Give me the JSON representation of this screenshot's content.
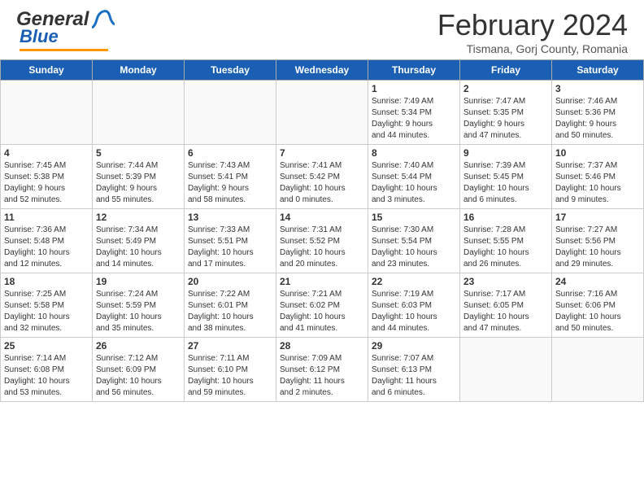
{
  "header": {
    "logo_general": "General",
    "logo_blue": "Blue",
    "title": "February 2024",
    "location": "Tismana, Gorj County, Romania"
  },
  "weekdays": [
    "Sunday",
    "Monday",
    "Tuesday",
    "Wednesday",
    "Thursday",
    "Friday",
    "Saturday"
  ],
  "weeks": [
    [
      {
        "day": "",
        "info": ""
      },
      {
        "day": "",
        "info": ""
      },
      {
        "day": "",
        "info": ""
      },
      {
        "day": "",
        "info": ""
      },
      {
        "day": "1",
        "info": "Sunrise: 7:49 AM\nSunset: 5:34 PM\nDaylight: 9 hours\nand 44 minutes."
      },
      {
        "day": "2",
        "info": "Sunrise: 7:47 AM\nSunset: 5:35 PM\nDaylight: 9 hours\nand 47 minutes."
      },
      {
        "day": "3",
        "info": "Sunrise: 7:46 AM\nSunset: 5:36 PM\nDaylight: 9 hours\nand 50 minutes."
      }
    ],
    [
      {
        "day": "4",
        "info": "Sunrise: 7:45 AM\nSunset: 5:38 PM\nDaylight: 9 hours\nand 52 minutes."
      },
      {
        "day": "5",
        "info": "Sunrise: 7:44 AM\nSunset: 5:39 PM\nDaylight: 9 hours\nand 55 minutes."
      },
      {
        "day": "6",
        "info": "Sunrise: 7:43 AM\nSunset: 5:41 PM\nDaylight: 9 hours\nand 58 minutes."
      },
      {
        "day": "7",
        "info": "Sunrise: 7:41 AM\nSunset: 5:42 PM\nDaylight: 10 hours\nand 0 minutes."
      },
      {
        "day": "8",
        "info": "Sunrise: 7:40 AM\nSunset: 5:44 PM\nDaylight: 10 hours\nand 3 minutes."
      },
      {
        "day": "9",
        "info": "Sunrise: 7:39 AM\nSunset: 5:45 PM\nDaylight: 10 hours\nand 6 minutes."
      },
      {
        "day": "10",
        "info": "Sunrise: 7:37 AM\nSunset: 5:46 PM\nDaylight: 10 hours\nand 9 minutes."
      }
    ],
    [
      {
        "day": "11",
        "info": "Sunrise: 7:36 AM\nSunset: 5:48 PM\nDaylight: 10 hours\nand 12 minutes."
      },
      {
        "day": "12",
        "info": "Sunrise: 7:34 AM\nSunset: 5:49 PM\nDaylight: 10 hours\nand 14 minutes."
      },
      {
        "day": "13",
        "info": "Sunrise: 7:33 AM\nSunset: 5:51 PM\nDaylight: 10 hours\nand 17 minutes."
      },
      {
        "day": "14",
        "info": "Sunrise: 7:31 AM\nSunset: 5:52 PM\nDaylight: 10 hours\nand 20 minutes."
      },
      {
        "day": "15",
        "info": "Sunrise: 7:30 AM\nSunset: 5:54 PM\nDaylight: 10 hours\nand 23 minutes."
      },
      {
        "day": "16",
        "info": "Sunrise: 7:28 AM\nSunset: 5:55 PM\nDaylight: 10 hours\nand 26 minutes."
      },
      {
        "day": "17",
        "info": "Sunrise: 7:27 AM\nSunset: 5:56 PM\nDaylight: 10 hours\nand 29 minutes."
      }
    ],
    [
      {
        "day": "18",
        "info": "Sunrise: 7:25 AM\nSunset: 5:58 PM\nDaylight: 10 hours\nand 32 minutes."
      },
      {
        "day": "19",
        "info": "Sunrise: 7:24 AM\nSunset: 5:59 PM\nDaylight: 10 hours\nand 35 minutes."
      },
      {
        "day": "20",
        "info": "Sunrise: 7:22 AM\nSunset: 6:01 PM\nDaylight: 10 hours\nand 38 minutes."
      },
      {
        "day": "21",
        "info": "Sunrise: 7:21 AM\nSunset: 6:02 PM\nDaylight: 10 hours\nand 41 minutes."
      },
      {
        "day": "22",
        "info": "Sunrise: 7:19 AM\nSunset: 6:03 PM\nDaylight: 10 hours\nand 44 minutes."
      },
      {
        "day": "23",
        "info": "Sunrise: 7:17 AM\nSunset: 6:05 PM\nDaylight: 10 hours\nand 47 minutes."
      },
      {
        "day": "24",
        "info": "Sunrise: 7:16 AM\nSunset: 6:06 PM\nDaylight: 10 hours\nand 50 minutes."
      }
    ],
    [
      {
        "day": "25",
        "info": "Sunrise: 7:14 AM\nSunset: 6:08 PM\nDaylight: 10 hours\nand 53 minutes."
      },
      {
        "day": "26",
        "info": "Sunrise: 7:12 AM\nSunset: 6:09 PM\nDaylight: 10 hours\nand 56 minutes."
      },
      {
        "day": "27",
        "info": "Sunrise: 7:11 AM\nSunset: 6:10 PM\nDaylight: 10 hours\nand 59 minutes."
      },
      {
        "day": "28",
        "info": "Sunrise: 7:09 AM\nSunset: 6:12 PM\nDaylight: 11 hours\nand 2 minutes."
      },
      {
        "day": "29",
        "info": "Sunrise: 7:07 AM\nSunset: 6:13 PM\nDaylight: 11 hours\nand 6 minutes."
      },
      {
        "day": "",
        "info": ""
      },
      {
        "day": "",
        "info": ""
      }
    ]
  ]
}
